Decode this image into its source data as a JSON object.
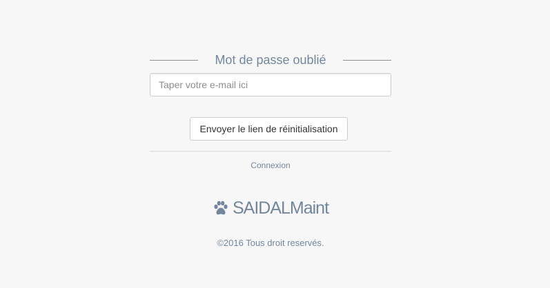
{
  "form": {
    "title": "Mot de passe oublié",
    "email_placeholder": "Taper votre e-mail ici",
    "email_value": "",
    "submit_label": "Envoyer le lien de réinitialisation",
    "login_link": "Connexion"
  },
  "brand": {
    "icon": "paw-icon",
    "name": "SAIDALMaint"
  },
  "footer": {
    "copyright": "©2016 Tous droit reservés."
  },
  "colors": {
    "background": "#f7f7f7",
    "text_muted": "#73879c",
    "border": "#cccccc"
  }
}
